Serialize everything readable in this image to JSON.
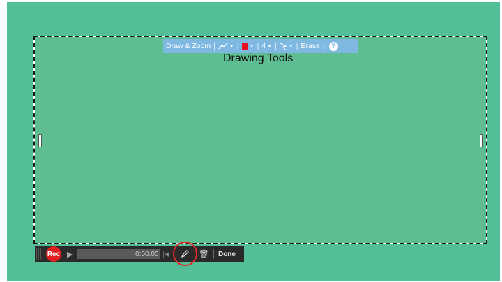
{
  "draw_toolbar": {
    "label": "Draw & Zoom",
    "pen_icon": "scribble-line-icon",
    "color_swatch": "#e8121e",
    "size_value": "4",
    "pointer_icon": "cursor-arrow-icon",
    "erase_label": "Erase",
    "help_label": "?"
  },
  "canvas": {
    "title": "Drawing Tools"
  },
  "recorder": {
    "rec_label": "Rec",
    "time": "0:00.00",
    "done_label": "Done",
    "rec_color": "#e11f1f",
    "highlight_ring_color": "#e02a2a"
  },
  "colors": {
    "background": "#54be97",
    "capture_area": "#5fbe91",
    "toolbar": "#7fb9e2"
  }
}
